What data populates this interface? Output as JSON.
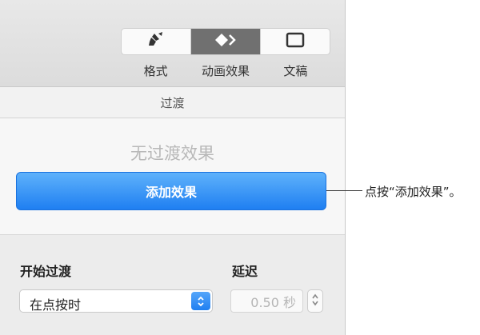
{
  "toolbar": {
    "tabs": [
      {
        "label": "格式",
        "icon": "paintbrush-icon",
        "active": false
      },
      {
        "label": "动画效果",
        "icon": "diamond-arrow-icon",
        "active": true
      },
      {
        "label": "文稿",
        "icon": "document-icon",
        "active": false
      }
    ]
  },
  "section": {
    "title": "过渡"
  },
  "transition": {
    "empty_text": "无过渡效果",
    "add_button": "添加效果"
  },
  "start": {
    "label": "开始过渡",
    "value": "在点按时"
  },
  "delay": {
    "label": "延迟",
    "value": "0.50 秒"
  },
  "callout": {
    "text": "点按“添加效果”。"
  },
  "colors": {
    "accent": "#1f7ff1",
    "active_tab": "#707070"
  }
}
